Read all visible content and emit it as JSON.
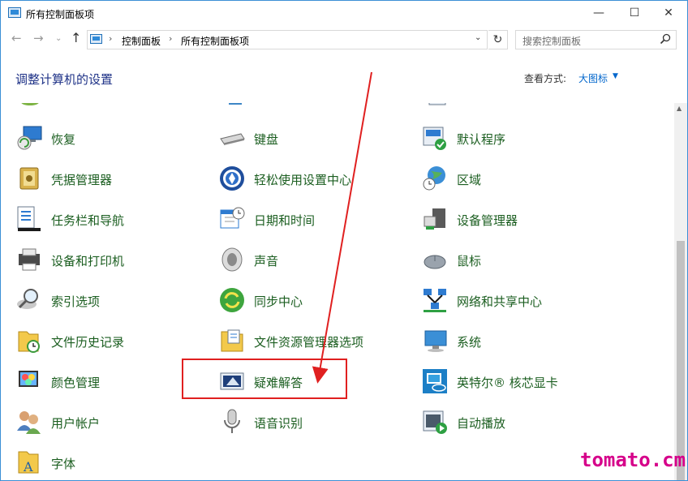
{
  "window": {
    "title": "所有控制面板项",
    "minimize": "—",
    "maximize": "☐",
    "close": "✕"
  },
  "address_bar": {
    "crumbs": [
      "控制面板",
      "所有控制面板项"
    ],
    "separator": "›",
    "search_placeholder": "搜索控制面板"
  },
  "header": {
    "title": "调整计算机的设置",
    "view_label": "查看方式:",
    "view_value": "大图标"
  },
  "items": {
    "col1": [
      "恢复",
      "凭据管理器",
      "任务栏和导航",
      "设备和打印机",
      "索引选项",
      "文件历史记录",
      "颜色管理",
      "用户帐户",
      "字体"
    ],
    "col2": [
      "键盘",
      "轻松使用设置中心",
      "日期和时间",
      "声音",
      "同步中心",
      "文件资源管理器选项",
      "疑难解答",
      "语音识别"
    ],
    "col3": [
      "默认程序",
      "区域",
      "设备管理器",
      "鼠标",
      "网络和共享中心",
      "系统",
      "英特尔® 核芯显卡",
      "自动播放"
    ]
  },
  "annotation": {
    "highlighted_item": "疑难解答",
    "arrow_color": "#e02020",
    "watermark": "tomato.cm"
  },
  "colors": {
    "item_text": "#1b5e20",
    "title_text": "#1e3287",
    "link": "#0066cc",
    "window_border": "#3b8fd6"
  }
}
